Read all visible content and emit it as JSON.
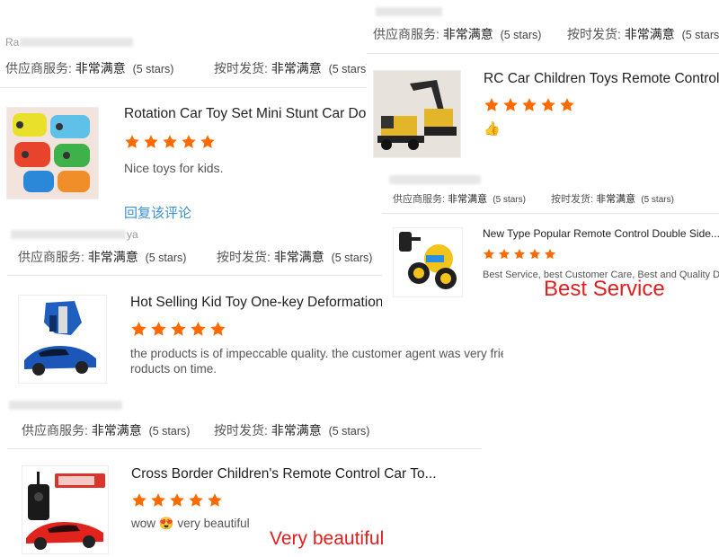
{
  "labels": {
    "supplier_service": "供应商服务:",
    "very_satisfied": "非常满意",
    "five_stars": "(5 stars)",
    "on_time_shipping": "按时发货:"
  },
  "star_count": 5,
  "star_color": "#ff6a00",
  "panel_a": {
    "reviewer_prefix": "Ra",
    "product_title": "Rotation Car Toy Set Mini Stunt Car Do",
    "review_text": "Nice toys for kids.",
    "reply_link": "回复该评论"
  },
  "panel_b": {
    "reviewer_suffix": "ya",
    "product_title": "Hot Selling Kid Toy One-key Deformation",
    "review_text": "the products is of impeccable quality. the customer agent was very friendly and e sired that I received the p roducts on time."
  },
  "panel_c": {
    "product_title": "Cross Border Children's Remote Control Car To...",
    "review_text_before": "wow",
    "review_text_after": "very beautiful",
    "emoji": "😍",
    "overlay_text": "Very beautiful"
  },
  "panel_d": {
    "product_title": "RC Car Children Toys Remote Control K",
    "review_emoji": "👍"
  },
  "panel_e": {
    "product_title": "New Type Popular Remote Control Double Side...",
    "review_text": "Best Service, best Customer Care, Best and Quality Devi",
    "overlay_text": "Best Service"
  }
}
